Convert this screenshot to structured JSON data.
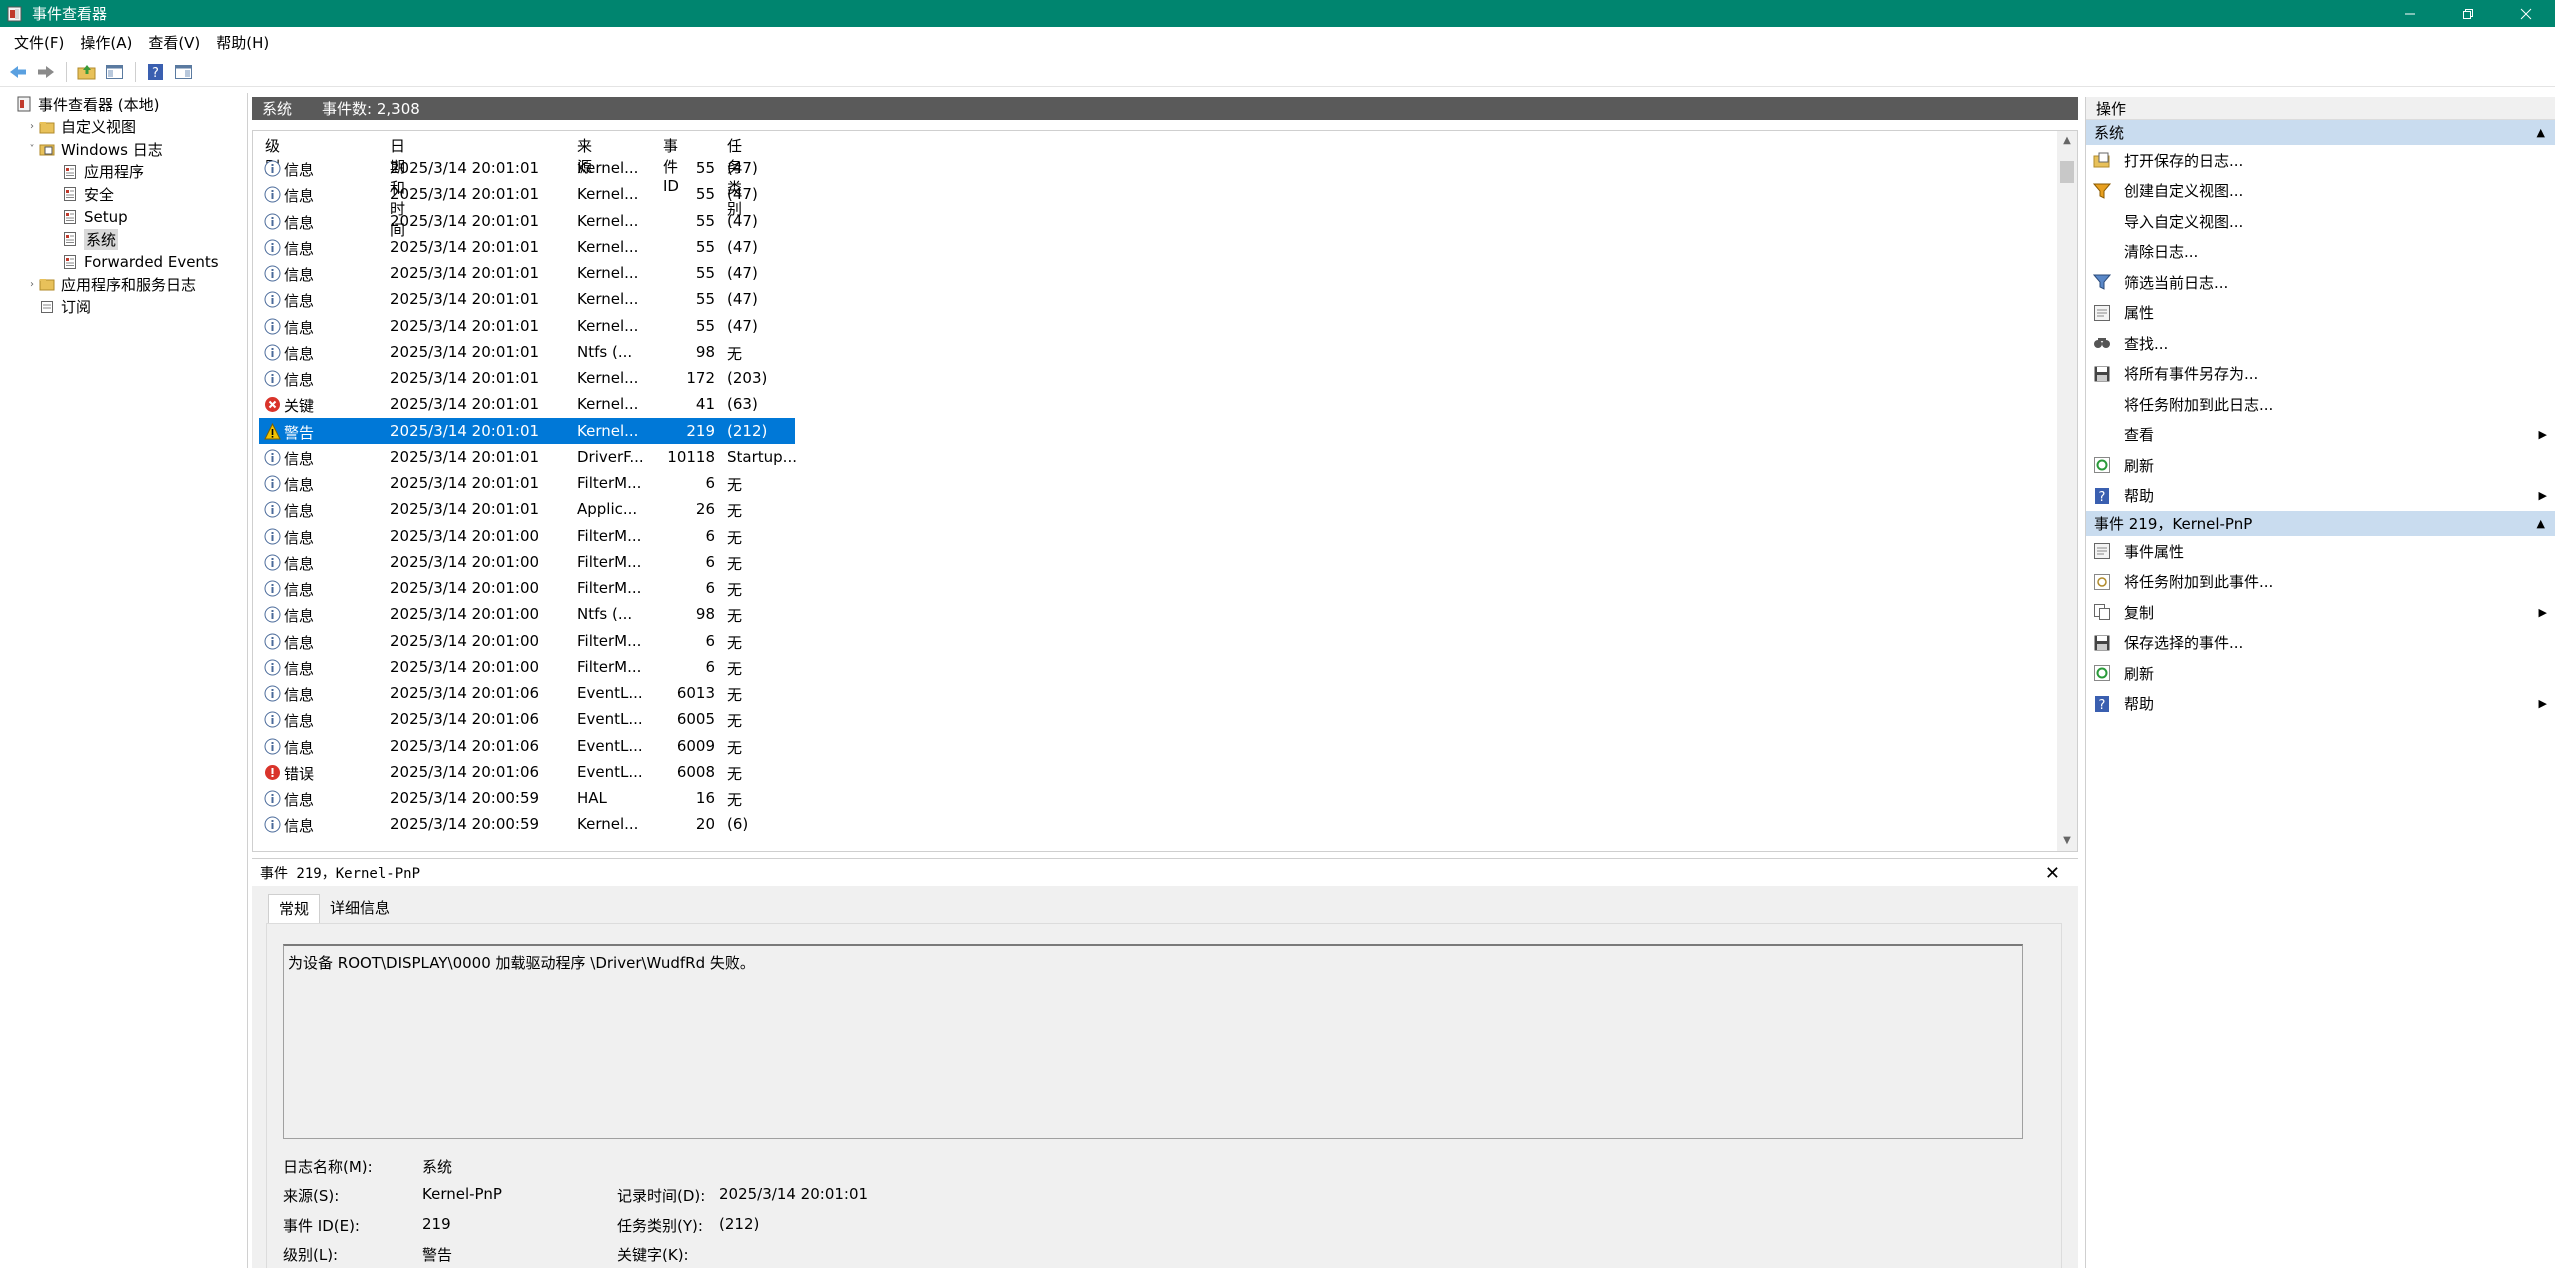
{
  "window": {
    "title": "事件查看器"
  },
  "menu": [
    "文件(F)",
    "操作(A)",
    "查看(V)",
    "帮助(H)"
  ],
  "tree": [
    {
      "label": "事件查看器 (本地)",
      "level": 0,
      "icon": "event-viewer-icon",
      "chev": ""
    },
    {
      "label": "自定义视图",
      "level": 1,
      "icon": "folder-icon",
      "chev": "›"
    },
    {
      "label": "Windows 日志",
      "level": 1,
      "icon": "folder-log-icon",
      "chev": "˅"
    },
    {
      "label": "应用程序",
      "level": 2,
      "icon": "log-icon",
      "chev": ""
    },
    {
      "label": "安全",
      "level": 2,
      "icon": "log-icon",
      "chev": ""
    },
    {
      "label": "Setup",
      "level": 2,
      "icon": "log-icon",
      "chev": ""
    },
    {
      "label": "系统",
      "level": 2,
      "icon": "log-icon",
      "chev": "",
      "selected": true
    },
    {
      "label": "Forwarded Events",
      "level": 2,
      "icon": "log-icon",
      "chev": ""
    },
    {
      "label": "应用程序和服务日志",
      "level": 1,
      "icon": "folder-icon",
      "chev": "›"
    },
    {
      "label": "订阅",
      "level": 1,
      "icon": "subscription-icon",
      "chev": ""
    }
  ],
  "center": {
    "log_name": "系统",
    "count_label": "事件数: 2,308"
  },
  "columns": [
    "级别",
    "日期和时间",
    "来源",
    "事件 ID",
    "任务类别"
  ],
  "events": [
    {
      "level": "信息",
      "type": "info",
      "datetime": "2025/3/14 20:01:01",
      "source": "Kernel...",
      "id": "55",
      "task": "(47)"
    },
    {
      "level": "信息",
      "type": "info",
      "datetime": "2025/3/14 20:01:01",
      "source": "Kernel...",
      "id": "55",
      "task": "(47)"
    },
    {
      "level": "信息",
      "type": "info",
      "datetime": "2025/3/14 20:01:01",
      "source": "Kernel...",
      "id": "55",
      "task": "(47)"
    },
    {
      "level": "信息",
      "type": "info",
      "datetime": "2025/3/14 20:01:01",
      "source": "Kernel...",
      "id": "55",
      "task": "(47)"
    },
    {
      "level": "信息",
      "type": "info",
      "datetime": "2025/3/14 20:01:01",
      "source": "Kernel...",
      "id": "55",
      "task": "(47)"
    },
    {
      "level": "信息",
      "type": "info",
      "datetime": "2025/3/14 20:01:01",
      "source": "Kernel...",
      "id": "55",
      "task": "(47)"
    },
    {
      "level": "信息",
      "type": "info",
      "datetime": "2025/3/14 20:01:01",
      "source": "Kernel...",
      "id": "55",
      "task": "(47)"
    },
    {
      "level": "信息",
      "type": "info",
      "datetime": "2025/3/14 20:01:01",
      "source": "Ntfs (...",
      "id": "98",
      "task": "无"
    },
    {
      "level": "信息",
      "type": "info",
      "datetime": "2025/3/14 20:01:01",
      "source": "Kernel...",
      "id": "172",
      "task": "(203)"
    },
    {
      "level": "关键",
      "type": "critical",
      "datetime": "2025/3/14 20:01:01",
      "source": "Kernel...",
      "id": "41",
      "task": "(63)"
    },
    {
      "level": "警告",
      "type": "warning",
      "datetime": "2025/3/14 20:01:01",
      "source": "Kernel...",
      "id": "219",
      "task": "(212)",
      "selected": true
    },
    {
      "level": "信息",
      "type": "info",
      "datetime": "2025/3/14 20:01:01",
      "source": "DriverF...",
      "id": "10118",
      "task": "Startup..."
    },
    {
      "level": "信息",
      "type": "info",
      "datetime": "2025/3/14 20:01:01",
      "source": "FilterM...",
      "id": "6",
      "task": "无"
    },
    {
      "level": "信息",
      "type": "info",
      "datetime": "2025/3/14 20:01:01",
      "source": "Applic...",
      "id": "26",
      "task": "无"
    },
    {
      "level": "信息",
      "type": "info",
      "datetime": "2025/3/14 20:01:00",
      "source": "FilterM...",
      "id": "6",
      "task": "无"
    },
    {
      "level": "信息",
      "type": "info",
      "datetime": "2025/3/14 20:01:00",
      "source": "FilterM...",
      "id": "6",
      "task": "无"
    },
    {
      "level": "信息",
      "type": "info",
      "datetime": "2025/3/14 20:01:00",
      "source": "FilterM...",
      "id": "6",
      "task": "无"
    },
    {
      "level": "信息",
      "type": "info",
      "datetime": "2025/3/14 20:01:00",
      "source": "Ntfs (...",
      "id": "98",
      "task": "无"
    },
    {
      "level": "信息",
      "type": "info",
      "datetime": "2025/3/14 20:01:00",
      "source": "FilterM...",
      "id": "6",
      "task": "无"
    },
    {
      "level": "信息",
      "type": "info",
      "datetime": "2025/3/14 20:01:00",
      "source": "FilterM...",
      "id": "6",
      "task": "无"
    },
    {
      "level": "信息",
      "type": "info",
      "datetime": "2025/3/14 20:01:06",
      "source": "EventL...",
      "id": "6013",
      "task": "无"
    },
    {
      "level": "信息",
      "type": "info",
      "datetime": "2025/3/14 20:01:06",
      "source": "EventL...",
      "id": "6005",
      "task": "无"
    },
    {
      "level": "信息",
      "type": "info",
      "datetime": "2025/3/14 20:01:06",
      "source": "EventL...",
      "id": "6009",
      "task": "无"
    },
    {
      "level": "错误",
      "type": "error",
      "datetime": "2025/3/14 20:01:06",
      "source": "EventL...",
      "id": "6008",
      "task": "无"
    },
    {
      "level": "信息",
      "type": "info",
      "datetime": "2025/3/14 20:00:59",
      "source": "HAL",
      "id": "16",
      "task": "无"
    },
    {
      "level": "信息",
      "type": "info",
      "datetime": "2025/3/14 20:00:59",
      "source": "Kernel...",
      "id": "20",
      "task": "(6)"
    }
  ],
  "detail": {
    "header": "事件 219，Kernel-PnP",
    "tabs": [
      "常规",
      "详细信息"
    ],
    "message": "为设备 ROOT\\DISPLAY\\0000 加载驱动程序 \\Driver\\WudfRd 失败。",
    "fields": {
      "log_name_label": "日志名称(M):",
      "log_name": "系统",
      "source_label": "来源(S):",
      "source": "Kernel-PnP",
      "logged_label": "记录时间(D):",
      "logged": "2025/3/14 20:01:01",
      "event_id_label": "事件 ID(E):",
      "event_id": "219",
      "task_label": "任务类别(Y):",
      "task": "(212)",
      "level_label": "级别(L):",
      "level": "警告",
      "keywords_label": "关键字(K):"
    }
  },
  "actions": {
    "title": "操作",
    "section1": "系统",
    "items1": [
      {
        "label": "打开保存的日志...",
        "icon": "open-log-icon"
      },
      {
        "label": "创建自定义视图...",
        "icon": "filter-create-icon"
      },
      {
        "label": "导入自定义视图...",
        "icon": ""
      },
      {
        "label": "清除日志...",
        "icon": ""
      },
      {
        "label": "筛选当前日志...",
        "icon": "filter-icon"
      },
      {
        "label": "属性",
        "icon": "properties-icon"
      },
      {
        "label": "查找...",
        "icon": "find-icon"
      },
      {
        "label": "将所有事件另存为...",
        "icon": "save-icon"
      },
      {
        "label": "将任务附加到此日志...",
        "icon": ""
      },
      {
        "label": "查看",
        "icon": "",
        "submenu": true
      },
      {
        "label": "刷新",
        "icon": "refresh-icon"
      },
      {
        "label": "帮助",
        "icon": "help-icon",
        "submenu": true
      }
    ],
    "section2": "事件 219，Kernel-PnP",
    "items2": [
      {
        "label": "事件属性",
        "icon": "properties-icon"
      },
      {
        "label": "将任务附加到此事件...",
        "icon": "task-icon"
      },
      {
        "label": "复制",
        "icon": "copy-icon",
        "submenu": true
      },
      {
        "label": "保存选择的事件...",
        "icon": "save-icon"
      },
      {
        "label": "刷新",
        "icon": "refresh-icon"
      },
      {
        "label": "帮助",
        "icon": "help-icon",
        "submenu": true
      }
    ]
  },
  "colors": {
    "titlebar": "#00856f",
    "selection": "#0078d7",
    "section_header": "#c9dcef"
  }
}
